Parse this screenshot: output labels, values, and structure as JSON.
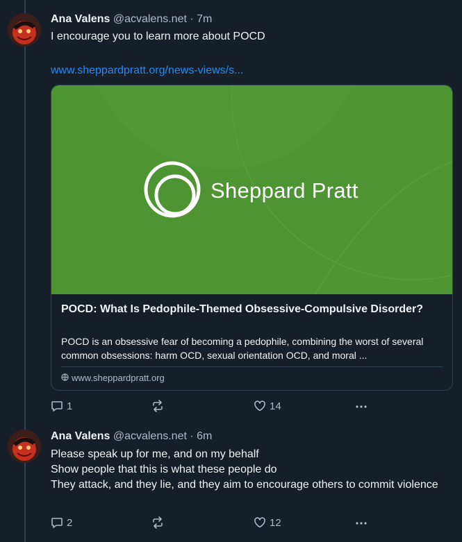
{
  "posts": [
    {
      "author": "Ana Valens",
      "handle": "@acvalens.net",
      "separator": " · ",
      "time": "7m",
      "text_lines": [
        "I encourage you to learn more about POCD"
      ],
      "link": "www.sheppardpratt.org/news-views/s...",
      "card": {
        "brand": "Sheppard Pratt",
        "title": "POCD: What Is Pedophile-Themed Obsessive-Compulsive Disorder?",
        "description": "POCD is an obsessive fear of becoming a pedophile, combining the worst of several common obsessions: harm OCD, sexual orientation OCD, and moral ...",
        "domain": "www.sheppardpratt.org",
        "brand_color": "#4e9433"
      },
      "replies": "1",
      "reposts": "",
      "likes": "14"
    },
    {
      "author": "Ana Valens",
      "handle": "@acvalens.net",
      "separator": " · ",
      "time": "6m",
      "text_lines": [
        "Please speak up for me, and on my behalf",
        "Show people that this is what these people do",
        "They attack, and they lie, and they aim to encourage others to commit violence"
      ],
      "replies": "2",
      "reposts": "",
      "likes": "12"
    }
  ],
  "icons": {
    "reply": "speech-bubble-icon",
    "repost": "repost-arrows-icon",
    "like": "heart-icon",
    "more": "ellipsis-icon",
    "domain": "globe-icon"
  },
  "colors": {
    "background": "#161e27",
    "link": "#208bfe",
    "muted": "#aebbc9"
  }
}
